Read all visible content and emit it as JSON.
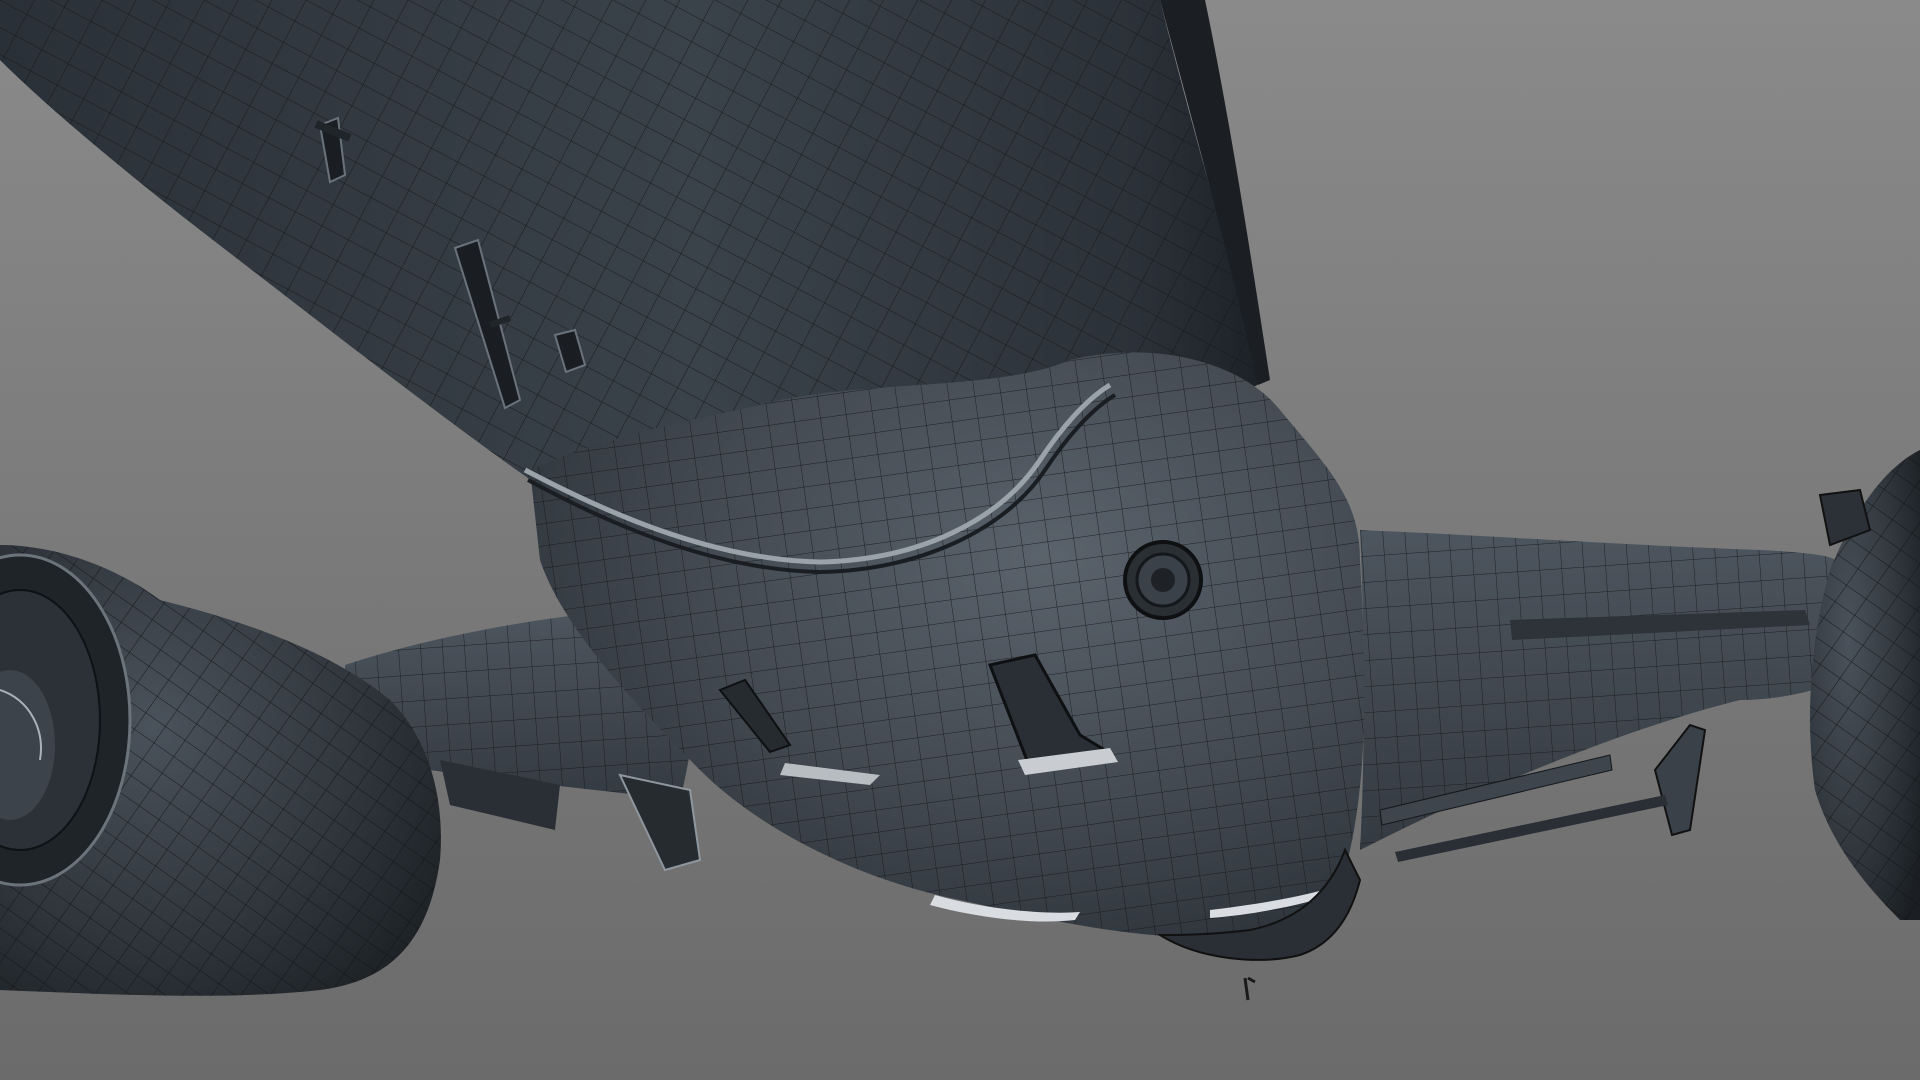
{
  "viewport": {
    "background_top": "#8a8a8a",
    "background_bottom": "#6e6e6e",
    "mesh_fill_dark": "#22272c",
    "mesh_fill_mid": "#3c434b",
    "mesh_fill_light": "#5c646d",
    "wire_color": "#15181b",
    "highlight_color": "#d9dde1"
  }
}
